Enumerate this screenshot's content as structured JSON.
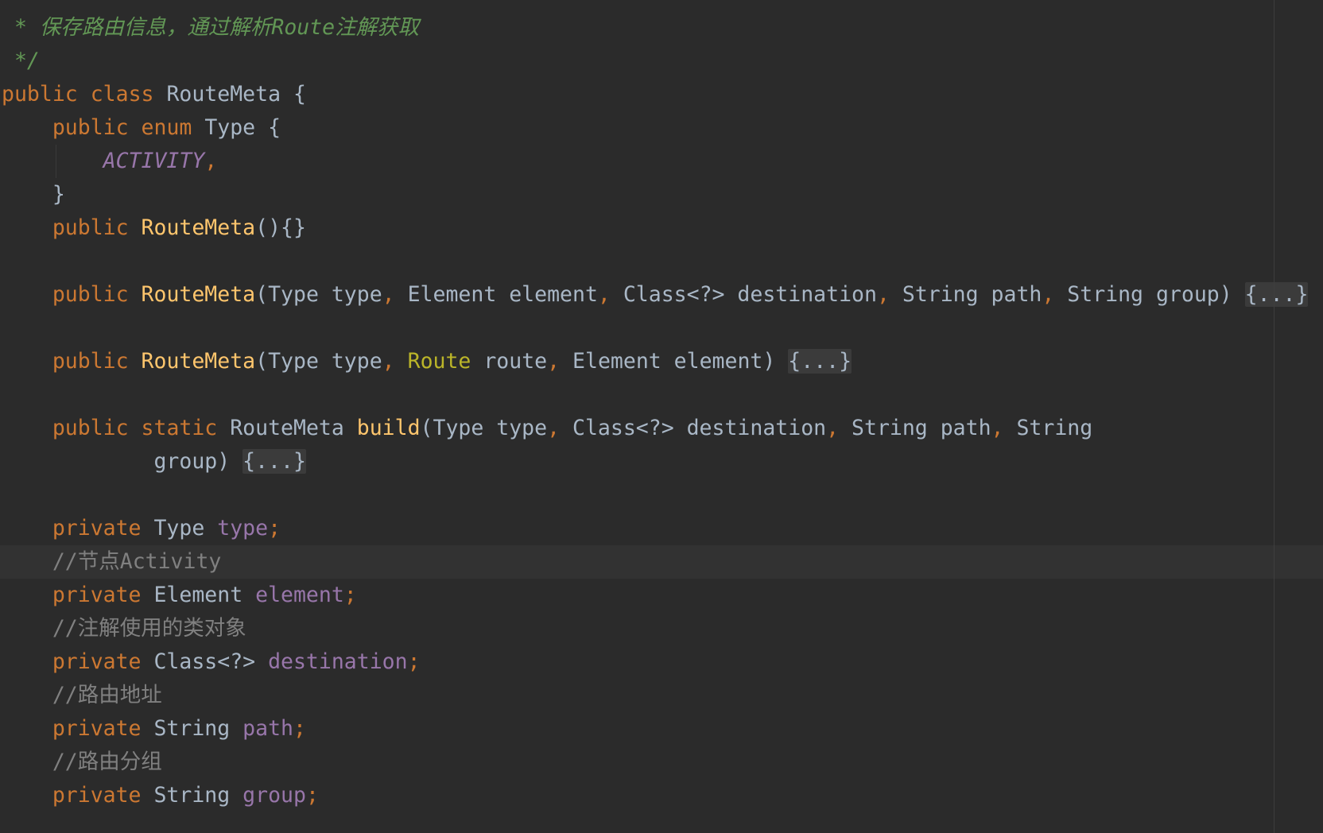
{
  "editor": {
    "colors": {
      "background": "#2B2B2B",
      "text": "#A9B7C6",
      "keyword": "#CC7832",
      "method": "#FFC66D",
      "annotation": "#BBB529",
      "field": "#9876AA",
      "doc_comment": "#629755",
      "line_comment": "#808080",
      "fold_background": "#3B3B3B",
      "current_line": "#323232"
    },
    "lines": [
      {
        "tokens": [
          {
            "t": " * 保存路由信息，通过解析Route注解获取",
            "k": "doc"
          }
        ]
      },
      {
        "tokens": [
          {
            "t": " */",
            "k": "doc"
          }
        ]
      },
      {
        "tokens": [
          {
            "t": "public",
            "k": "kw"
          },
          {
            "t": " ",
            "k": "plain"
          },
          {
            "t": "class",
            "k": "kw"
          },
          {
            "t": " RouteMeta {",
            "k": "plain"
          }
        ]
      },
      {
        "tokens": [
          {
            "t": "    ",
            "k": "plain"
          },
          {
            "t": "public",
            "k": "kw"
          },
          {
            "t": " ",
            "k": "plain"
          },
          {
            "t": "enum",
            "k": "kw"
          },
          {
            "t": " Type {",
            "k": "plain"
          }
        ]
      },
      {
        "tokens": [
          {
            "t": "        ",
            "k": "plain"
          },
          {
            "t": "ACTIVITY",
            "k": "enum"
          },
          {
            "t": ",",
            "k": "punct"
          }
        ]
      },
      {
        "tokens": [
          {
            "t": "    }",
            "k": "plain"
          }
        ]
      },
      {
        "tokens": [
          {
            "t": "    ",
            "k": "plain"
          },
          {
            "t": "public",
            "k": "kw"
          },
          {
            "t": " ",
            "k": "plain"
          },
          {
            "t": "RouteMeta",
            "k": "fn"
          },
          {
            "t": "(){}",
            "k": "plain"
          }
        ]
      },
      {
        "tokens": []
      },
      {
        "tokens": [
          {
            "t": "    ",
            "k": "plain"
          },
          {
            "t": "public",
            "k": "kw"
          },
          {
            "t": " ",
            "k": "plain"
          },
          {
            "t": "RouteMeta",
            "k": "fn"
          },
          {
            "t": "(Type type",
            "k": "plain"
          },
          {
            "t": ",",
            "k": "punct"
          },
          {
            "t": " Element element",
            "k": "plain"
          },
          {
            "t": ",",
            "k": "punct"
          },
          {
            "t": " Class<?> destination",
            "k": "plain"
          },
          {
            "t": ",",
            "k": "punct"
          },
          {
            "t": " String path",
            "k": "plain"
          },
          {
            "t": ",",
            "k": "punct"
          },
          {
            "t": " String group) ",
            "k": "plain"
          },
          {
            "t": "{...}",
            "k": "fold"
          }
        ]
      },
      {
        "tokens": []
      },
      {
        "tokens": [
          {
            "t": "    ",
            "k": "plain"
          },
          {
            "t": "public",
            "k": "kw"
          },
          {
            "t": " ",
            "k": "plain"
          },
          {
            "t": "RouteMeta",
            "k": "fn"
          },
          {
            "t": "(Type type",
            "k": "plain"
          },
          {
            "t": ",",
            "k": "punct"
          },
          {
            "t": " ",
            "k": "plain"
          },
          {
            "t": "Route",
            "k": "ann"
          },
          {
            "t": " route",
            "k": "plain"
          },
          {
            "t": ",",
            "k": "punct"
          },
          {
            "t": " Element element) ",
            "k": "plain"
          },
          {
            "t": "{...}",
            "k": "fold"
          }
        ]
      },
      {
        "tokens": []
      },
      {
        "tokens": [
          {
            "t": "    ",
            "k": "plain"
          },
          {
            "t": "public",
            "k": "kw"
          },
          {
            "t": " ",
            "k": "plain"
          },
          {
            "t": "static",
            "k": "kw"
          },
          {
            "t": " RouteMeta ",
            "k": "plain"
          },
          {
            "t": "build",
            "k": "fn"
          },
          {
            "t": "(Type type",
            "k": "plain"
          },
          {
            "t": ",",
            "k": "punct"
          },
          {
            "t": " Class<?> destination",
            "k": "plain"
          },
          {
            "t": ",",
            "k": "punct"
          },
          {
            "t": " String path",
            "k": "plain"
          },
          {
            "t": ",",
            "k": "punct"
          },
          {
            "t": " String",
            "k": "plain"
          }
        ]
      },
      {
        "tokens": [
          {
            "t": "            group) ",
            "k": "plain"
          },
          {
            "t": "{...}",
            "k": "fold"
          }
        ]
      },
      {
        "tokens": []
      },
      {
        "tokens": [
          {
            "t": "    ",
            "k": "plain"
          },
          {
            "t": "private",
            "k": "kw"
          },
          {
            "t": " Type ",
            "k": "plain"
          },
          {
            "t": "type",
            "k": "field"
          },
          {
            "t": ";",
            "k": "punct"
          }
        ]
      },
      {
        "tokens": [
          {
            "t": "    ",
            "k": "plain"
          },
          {
            "t": "//节点Activity",
            "k": "comment"
          }
        ],
        "current": true
      },
      {
        "tokens": [
          {
            "t": "    ",
            "k": "plain"
          },
          {
            "t": "private",
            "k": "kw"
          },
          {
            "t": " Element ",
            "k": "plain"
          },
          {
            "t": "element",
            "k": "field"
          },
          {
            "t": ";",
            "k": "punct"
          }
        ]
      },
      {
        "tokens": [
          {
            "t": "    ",
            "k": "plain"
          },
          {
            "t": "//注解使用的类对象",
            "k": "comment"
          }
        ]
      },
      {
        "tokens": [
          {
            "t": "    ",
            "k": "plain"
          },
          {
            "t": "private",
            "k": "kw"
          },
          {
            "t": " Class<?> ",
            "k": "plain"
          },
          {
            "t": "destination",
            "k": "field"
          },
          {
            "t": ";",
            "k": "punct"
          }
        ]
      },
      {
        "tokens": [
          {
            "t": "    ",
            "k": "plain"
          },
          {
            "t": "//路由地址",
            "k": "comment"
          }
        ]
      },
      {
        "tokens": [
          {
            "t": "    ",
            "k": "plain"
          },
          {
            "t": "private",
            "k": "kw"
          },
          {
            "t": " String ",
            "k": "plain"
          },
          {
            "t": "path",
            "k": "field"
          },
          {
            "t": ";",
            "k": "punct"
          }
        ]
      },
      {
        "tokens": [
          {
            "t": "    ",
            "k": "plain"
          },
          {
            "t": "//路由分组",
            "k": "comment"
          }
        ]
      },
      {
        "tokens": [
          {
            "t": "    ",
            "k": "plain"
          },
          {
            "t": "private",
            "k": "kw"
          },
          {
            "t": " String ",
            "k": "plain"
          },
          {
            "t": "group",
            "k": "field"
          },
          {
            "t": ";",
            "k": "punct"
          }
        ]
      }
    ]
  }
}
